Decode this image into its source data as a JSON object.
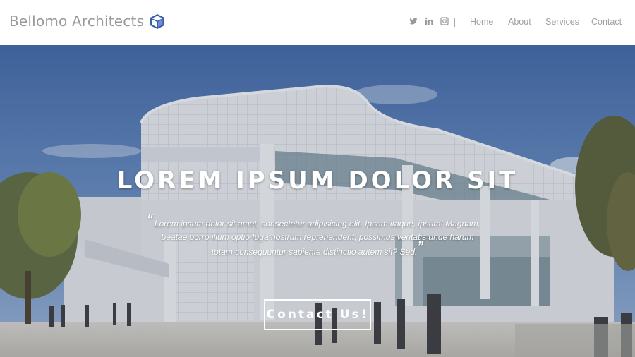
{
  "header": {
    "brand_name": "Bellomo Architects",
    "logo_icon": "cube-icon",
    "social": [
      "twitter-icon",
      "linkedin-icon",
      "instagram-icon"
    ],
    "nav": [
      "Home",
      "About",
      "Services",
      "Contact"
    ]
  },
  "hero": {
    "title": "LOREM IPSUM DOLOR SIT",
    "quote": "Lorem ipsum dolor sit amet, consectetur adipisicing elit. Ipsam itaque, ipsum! Magnam, beatae porro illum optio fuga nostrum reprehenderit, possimus veritatis unde harum totam consequuntur sapiente distinctio autem sit? Sed.",
    "cta_label": "Contact Us!"
  },
  "colors": {
    "brand_text": "#9a9a9a",
    "logo_blue": "#3a5ea8",
    "nav_text": "#a0a0a0",
    "sky": "#5b7fb8"
  }
}
